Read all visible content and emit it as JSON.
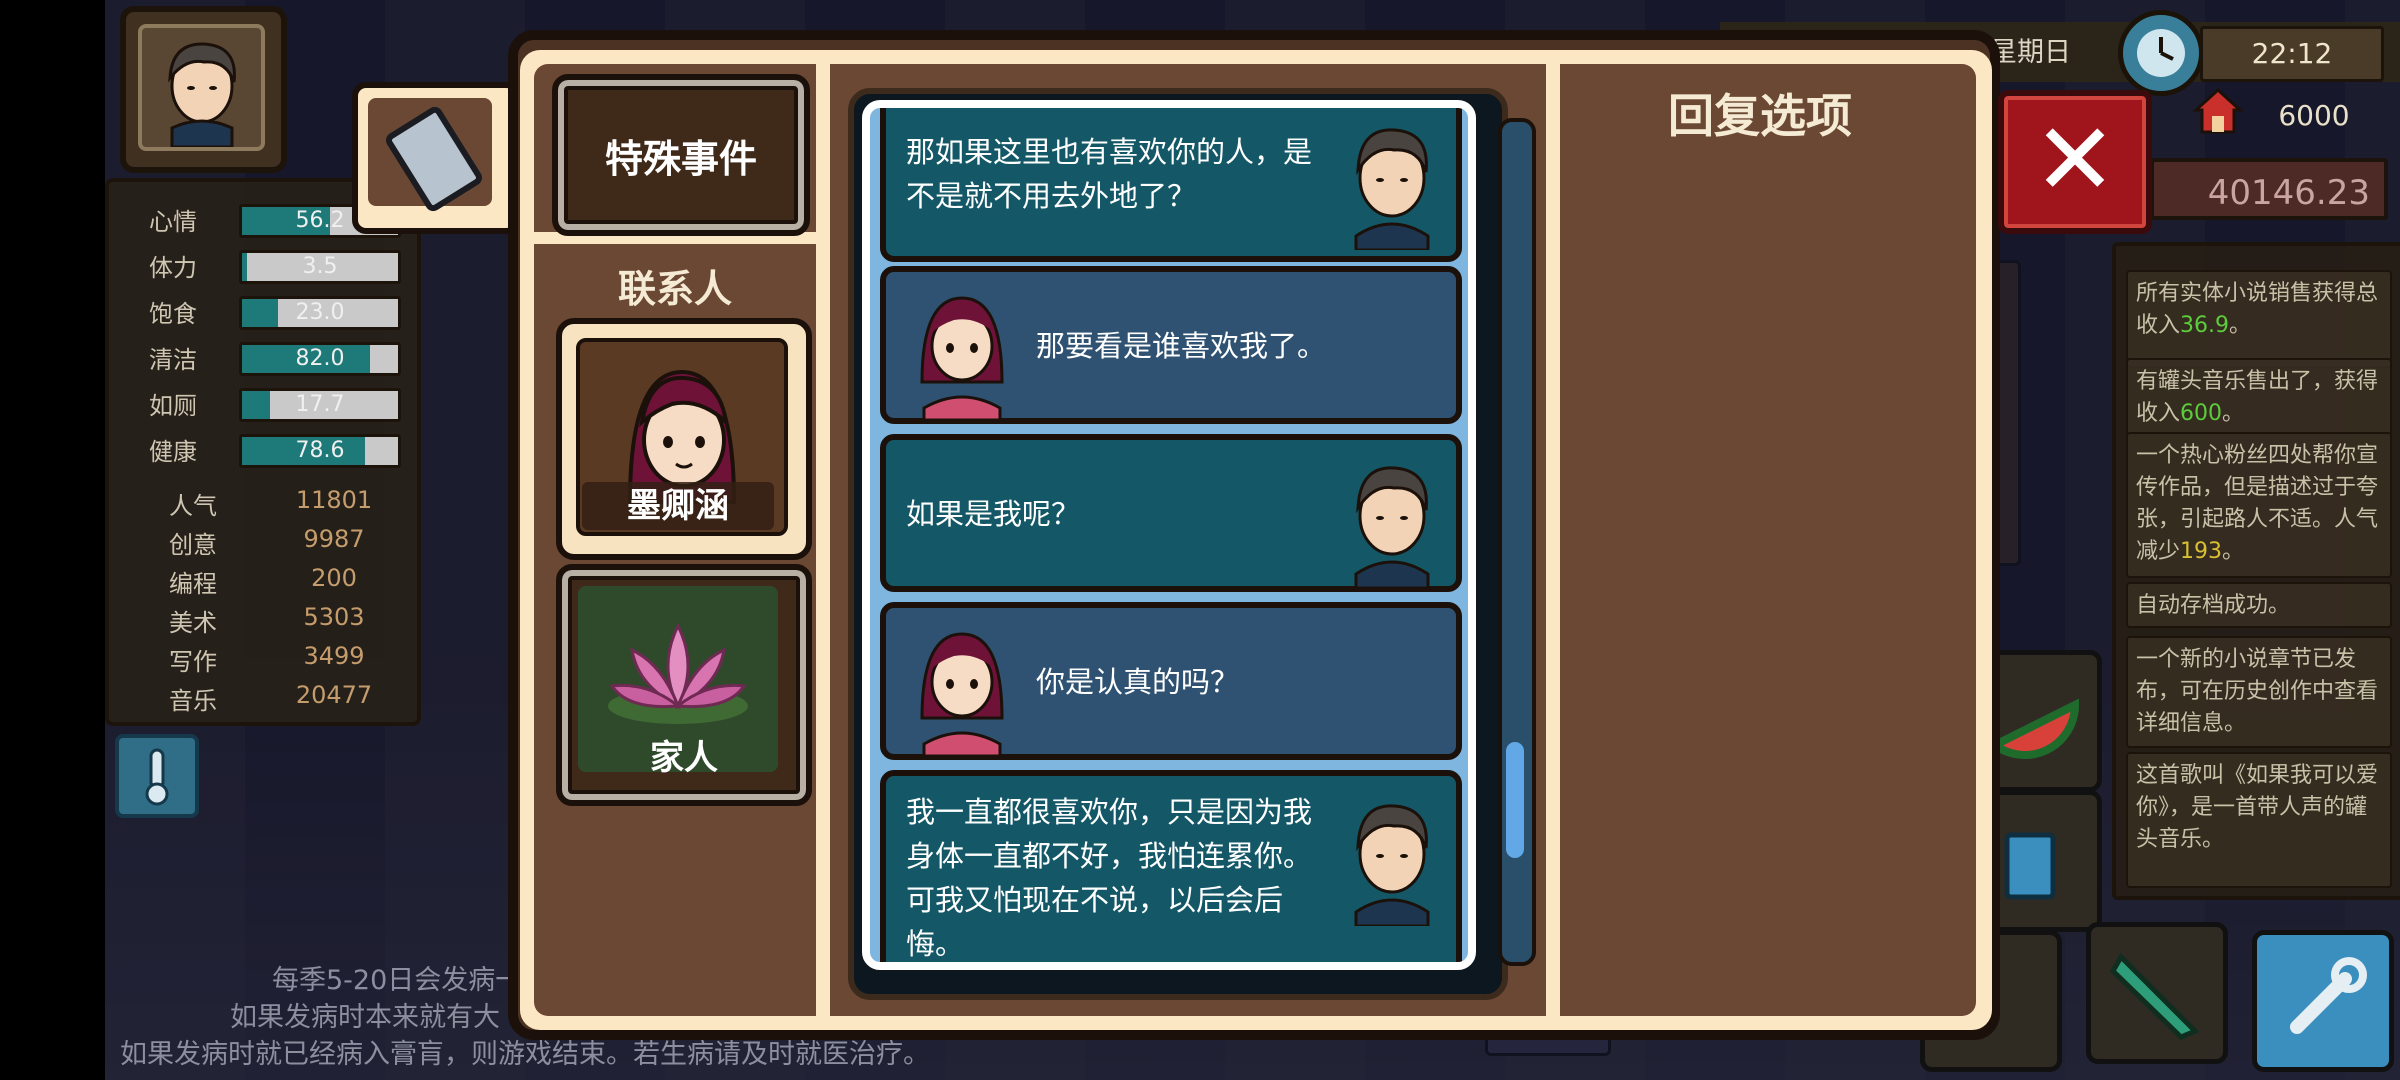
{
  "hud": {
    "weekday": "星期日",
    "time": "22:12",
    "money": "6000",
    "balance": "40146.23"
  },
  "stats": [
    {
      "label": "心情",
      "value": "56.2",
      "fill": 0.562
    },
    {
      "label": "体力",
      "value": "3.5",
      "fill": 0.035
    },
    {
      "label": "饱食",
      "value": "23.0",
      "fill": 0.23
    },
    {
      "label": "清洁",
      "value": "82.0",
      "fill": 0.82
    },
    {
      "label": "如厕",
      "value": "17.7",
      "fill": 0.177
    },
    {
      "label": "健康",
      "value": "78.6",
      "fill": 0.786
    }
  ],
  "attributes": [
    {
      "label": "人气",
      "value": "11801"
    },
    {
      "label": "创意",
      "value": "9987"
    },
    {
      "label": "编程",
      "value": "200"
    },
    {
      "label": "美术",
      "value": "5303"
    },
    {
      "label": "写作",
      "value": "3499"
    },
    {
      "label": "音乐",
      "value": "20477"
    }
  ],
  "notice": {
    "line1": "每季5-20日会发病一",
    "line2": "如果发病时本来就有大",
    "line3": "如果发病时就已经病入膏肓，则游戏结束。若生病请及时就医治疗。"
  },
  "log": {
    "item1_pre": "所有实体小说销售获得总收入",
    "item1_value": "36.9",
    "item1_post": "。",
    "item2_pre": "有罐头音乐售出了，获得收入",
    "item2_value": "600",
    "item2_post": "。",
    "item3_pre": "一个热心粉丝四处帮你宣传作品，但是描述过于夸张，引起路人不适。人气减少",
    "item3_value": "193",
    "item3_post": "。",
    "item4": "自动存档成功。",
    "item5": "一个新的小说章节已发布，可在历史创作中查看详细信息。",
    "item6": "这首歌叫《如果我可以爱你》，是一首带人声的罐头音乐。"
  },
  "dialog": {
    "special_events": "特殊事件",
    "contacts_title": "联系人",
    "contact1_name": "墨卿涵",
    "contact2_name": "家人",
    "reply_title": "回复选项",
    "messages": [
      {
        "from": "me",
        "text": "那如果这里也有喜欢你的人，是不是就不用去外地了？"
      },
      {
        "from": "her",
        "text": "那要看是谁喜欢我了。"
      },
      {
        "from": "me",
        "text": "如果是我呢？"
      },
      {
        "from": "her",
        "text": "你是认真的吗？"
      },
      {
        "from": "me",
        "text": "我一直都很喜欢你，只是因为我身体一直都不好，我怕连累你。可我又怕现在不说，以后会后悔。"
      }
    ]
  },
  "colors": {
    "accent_cream": "#fbe7c4",
    "panel_brown": "#6b4833",
    "close_red": "#a0141c",
    "bubble_me": "#145867",
    "bubble_her": "#2f5272",
    "stat_fill": "#1e7a78"
  },
  "icons": {
    "phone": "phone-icon",
    "close": "close-icon",
    "clock": "clock-icon",
    "house": "house-icon",
    "thermometer": "thermometer-icon"
  }
}
